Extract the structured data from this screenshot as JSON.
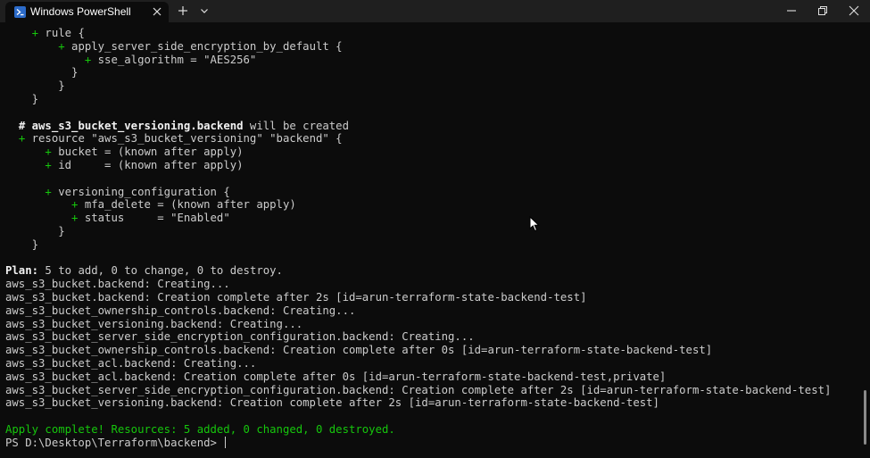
{
  "titlebar": {
    "tab_title": "Windows PowerShell",
    "icons": {
      "app": "powershell-icon",
      "tab_close": "close-icon",
      "new_tab": "plus-icon",
      "dropdown": "chevron-down-icon",
      "minimize": "minimize-icon",
      "maximize": "restore-icon",
      "close": "close-icon"
    }
  },
  "terminal": {
    "lines": [
      {
        "indent": "    ",
        "marker": "+",
        "text": " rule {"
      },
      {
        "indent": "        ",
        "marker": "+",
        "text": " apply_server_side_encryption_by_default {"
      },
      {
        "indent": "            ",
        "marker": "+",
        "text": " sse_algorithm = \"AES256\""
      },
      {
        "indent": "          ",
        "text": "}"
      },
      {
        "indent": "        ",
        "text": "}"
      },
      {
        "indent": "    ",
        "text": "}"
      },
      {
        "text": ""
      },
      {
        "indent": "  ",
        "bold": "# aws_s3_bucket_versioning.backend",
        "text": " will be created"
      },
      {
        "indent": "  ",
        "marker": "+",
        "text": " resource \"aws_s3_bucket_versioning\" \"backend\" {"
      },
      {
        "indent": "      ",
        "marker": "+",
        "text": " bucket = (known after apply)"
      },
      {
        "indent": "      ",
        "marker": "+",
        "text": " id     = (known after apply)"
      },
      {
        "text": ""
      },
      {
        "indent": "      ",
        "marker": "+",
        "text": " versioning_configuration {"
      },
      {
        "indent": "          ",
        "marker": "+",
        "text": " mfa_delete = (known after apply)"
      },
      {
        "indent": "          ",
        "marker": "+",
        "text": " status     = \"Enabled\""
      },
      {
        "indent": "        ",
        "text": "}"
      },
      {
        "indent": "    ",
        "text": "}"
      },
      {
        "text": ""
      },
      {
        "bold": "Plan:",
        "text": " 5 to add, 0 to change, 0 to destroy."
      },
      {
        "text": "aws_s3_bucket.backend: Creating..."
      },
      {
        "text": "aws_s3_bucket.backend: Creation complete after 2s [id=arun-terraform-state-backend-test]"
      },
      {
        "text": "aws_s3_bucket_ownership_controls.backend: Creating..."
      },
      {
        "text": "aws_s3_bucket_versioning.backend: Creating..."
      },
      {
        "text": "aws_s3_bucket_server_side_encryption_configuration.backend: Creating..."
      },
      {
        "text": "aws_s3_bucket_ownership_controls.backend: Creation complete after 0s [id=arun-terraform-state-backend-test]"
      },
      {
        "text": "aws_s3_bucket_acl.backend: Creating..."
      },
      {
        "text": "aws_s3_bucket_acl.backend: Creation complete after 0s [id=arun-terraform-state-backend-test,private]"
      },
      {
        "text": "aws_s3_bucket_server_side_encryption_configuration.backend: Creation complete after 2s [id=arun-terraform-state-backend-test]"
      },
      {
        "text": "aws_s3_bucket_versioning.backend: Creation complete after 2s [id=arun-terraform-state-backend-test]"
      },
      {
        "text": ""
      },
      {
        "green": "Apply complete! Resources: 5 added, 0 changed, 0 destroyed."
      },
      {
        "text": "PS D:\\Desktop\\Terraform\\backend> ",
        "cursor": true
      }
    ]
  },
  "colors": {
    "background": "#0c0c0c",
    "titlebar": "#1f1f1f",
    "text": "#cccccc",
    "green": "#16c60c",
    "bold": "#f2f2f2",
    "powershell_icon": "#2c6bc9"
  }
}
